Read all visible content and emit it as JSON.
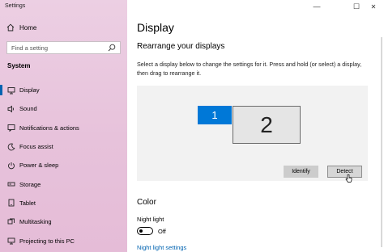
{
  "window": {
    "title": "Settings",
    "minimize": "—",
    "maximize": "☐",
    "close": "✕"
  },
  "sidebar": {
    "home": "Home",
    "search_placeholder": "Find a setting",
    "section": "System",
    "items": [
      {
        "label": "Display",
        "icon": "monitor-icon",
        "active": true
      },
      {
        "label": "Sound",
        "icon": "speaker-icon"
      },
      {
        "label": "Notifications & actions",
        "icon": "notification-icon"
      },
      {
        "label": "Focus assist",
        "icon": "moon-icon"
      },
      {
        "label": "Power & sleep",
        "icon": "power-icon"
      },
      {
        "label": "Storage",
        "icon": "storage-icon"
      },
      {
        "label": "Tablet",
        "icon": "tablet-icon"
      },
      {
        "label": "Multitasking",
        "icon": "multitasking-icon"
      },
      {
        "label": "Projecting to this PC",
        "icon": "projector-icon"
      }
    ]
  },
  "main": {
    "title": "Display",
    "rearrange_heading": "Rearrange your displays",
    "rearrange_desc": "Select a display below to change the settings for it. Press and hold (or select) a display, then drag to rearrange it.",
    "display1": "1",
    "display2": "2",
    "identify": "Identify",
    "detect": "Detect",
    "color_heading": "Color",
    "night_light_label": "Night light",
    "night_light_state": "Off",
    "night_light_link": "Night light settings"
  },
  "colors": {
    "accent": "#0078d7",
    "link": "#0063b1",
    "sidebar": "#e9c6de"
  }
}
